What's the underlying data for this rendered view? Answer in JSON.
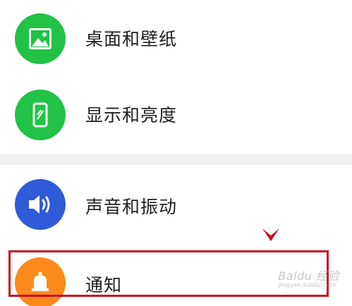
{
  "settings_list": {
    "items": [
      {
        "label": "桌面和壁纸",
        "icon": "image-icon",
        "color": "#21c245"
      },
      {
        "label": "显示和亮度",
        "icon": "phone-brightness-icon",
        "color": "#21c245"
      },
      {
        "label": "声音和振动",
        "icon": "speaker-icon",
        "color": "#2f5bd9"
      },
      {
        "label": "通知",
        "icon": "bell-icon",
        "color": "#ff8a1c"
      }
    ]
  },
  "annotation": {
    "highlight_color": "#c8101e"
  },
  "watermark": {
    "text": "Baidu 经验",
    "sub": "jingyan.baidu.com"
  }
}
